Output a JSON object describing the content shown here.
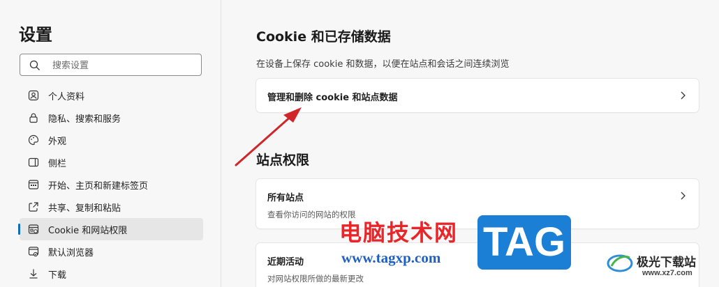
{
  "sidebar": {
    "title": "设置",
    "search_placeholder": "搜索设置",
    "items": [
      {
        "label": "个人资料",
        "icon": "profile-icon"
      },
      {
        "label": "隐私、搜索和服务",
        "icon": "lock-icon"
      },
      {
        "label": "外观",
        "icon": "palette-icon"
      },
      {
        "label": "侧栏",
        "icon": "sidebar-icon"
      },
      {
        "label": "开始、主页和新建标签页",
        "icon": "home-grid-icon"
      },
      {
        "label": "共享、复制和粘贴",
        "icon": "share-icon"
      },
      {
        "label": "Cookie 和网站权限",
        "icon": "cookie-permissions-icon",
        "active": true
      },
      {
        "label": "默认浏览器",
        "icon": "browser-icon"
      },
      {
        "label": "下载",
        "icon": "download-icon"
      }
    ]
  },
  "main": {
    "cookie_section": {
      "title": "Cookie 和已存储数据",
      "description": "在设备上保存 cookie 和数据，以便在站点和会话之间连续浏览",
      "manage_card": {
        "label": "管理和删除 cookie 和站点数据"
      }
    },
    "permissions_section": {
      "title": "站点权限",
      "all_sites": {
        "label": "所有站点",
        "sub": "查看你访问的网站的权限"
      },
      "recent_activity": {
        "label": "近期活动",
        "sub": "对网站权限所做的最新更改"
      }
    }
  },
  "watermark": {
    "text": "电脑技术网",
    "url": "www.tagxp.com",
    "tag": "TAG",
    "site_name": "极光下载站",
    "site_url": "www.xz7.com"
  },
  "colors": {
    "accent": "#0f6cbd",
    "annotation_arrow": "#d0262a"
  }
}
